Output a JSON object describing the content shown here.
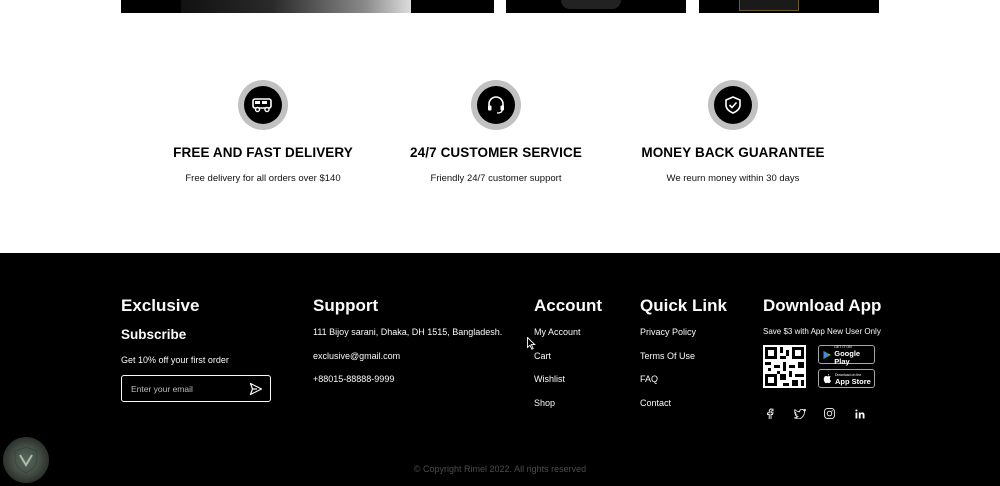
{
  "services": [
    {
      "icon": "delivery-van-icon",
      "title": "FREE AND FAST DELIVERY",
      "desc": "Free delivery for all orders over $140"
    },
    {
      "icon": "headset-icon",
      "title": "24/7 CUSTOMER SERVICE",
      "desc": "Friendly 24/7 customer support"
    },
    {
      "icon": "shield-check-icon",
      "title": "MONEY BACK GUARANTEE",
      "desc": "We reurn money within 30 days"
    }
  ],
  "footer": {
    "exclusive": {
      "title": "Exclusive",
      "subtitle": "Subscribe",
      "offer": "Get 10% off your first order",
      "email_placeholder": "Enter your email"
    },
    "support": {
      "title": "Support",
      "address": "111 Bijoy sarani, Dhaka, DH 1515, Bangladesh.",
      "email": "exclusive@gmail.com",
      "phone": "+88015-88888-9999"
    },
    "account": {
      "title": "Account",
      "links": [
        "My Account",
        "Cart",
        "Wishlist",
        "Shop"
      ]
    },
    "quick_link": {
      "title": "Quick Link",
      "links": [
        "Privacy Policy",
        "Terms Of Use",
        "FAQ",
        "Contact"
      ]
    },
    "download_app": {
      "title": "Download App",
      "note": "Save $3 with App New User Only",
      "google_play": {
        "small": "GET IT ON",
        "big": "Google Play"
      },
      "app_store": {
        "small": "Download on the",
        "big": "App Store"
      },
      "socials": [
        "facebook-icon",
        "twitter-icon",
        "instagram-icon",
        "linkedin-icon"
      ]
    },
    "copyright": "©  Copyright Rimel 2022. All rights reserved"
  },
  "colors": {
    "footer_bg": "#000000",
    "icon_ring": "#c1c1c1",
    "text_light": "#fafafa",
    "copyright": "#4d4d4d"
  }
}
